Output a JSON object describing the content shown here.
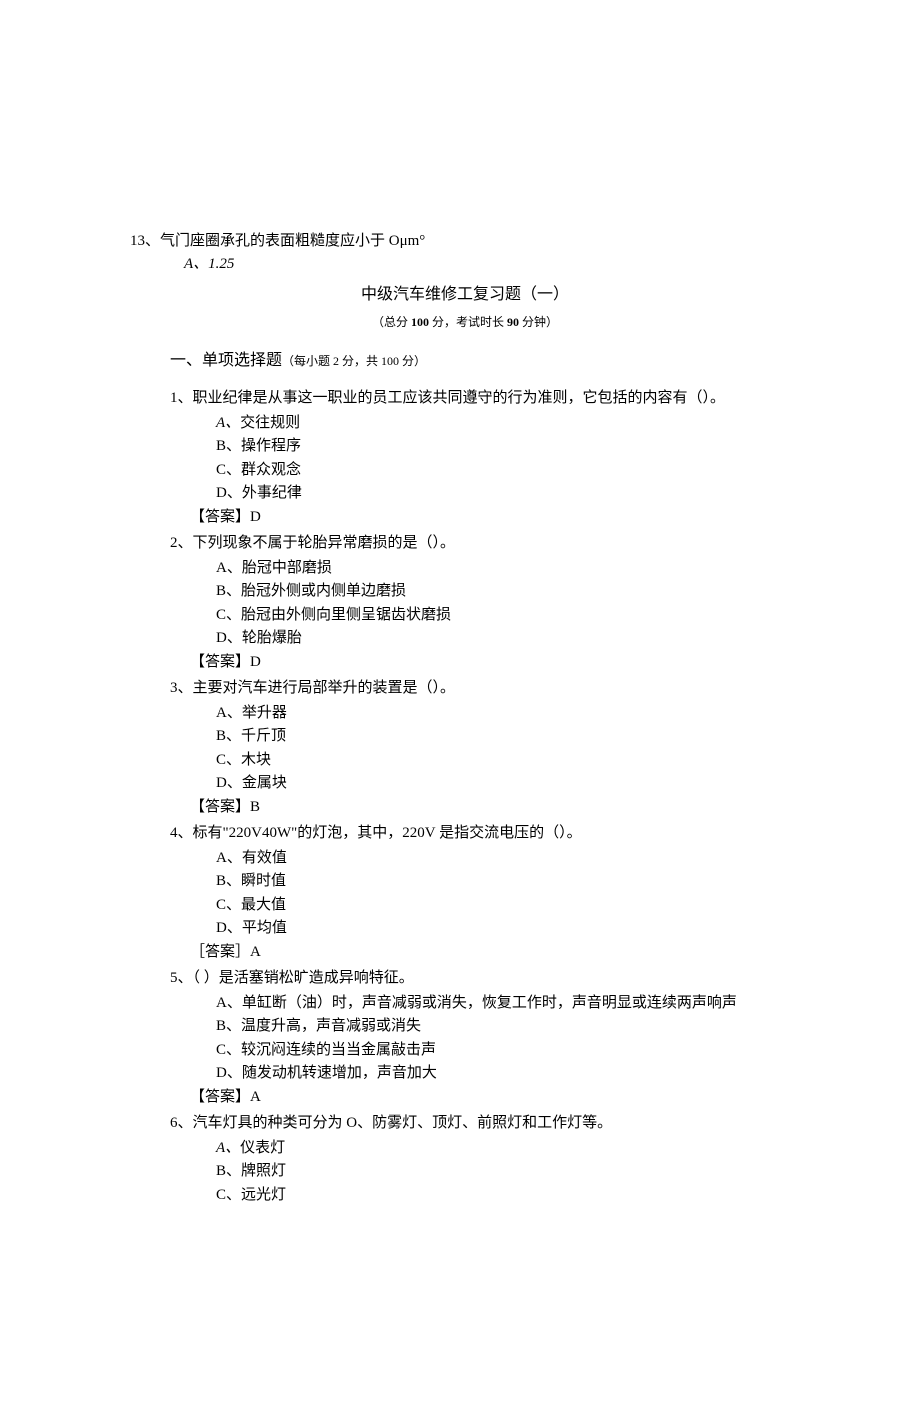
{
  "q13": {
    "num": "13、",
    "stem": "气门座圈承孔的表面粗糙度应小于 Oμm°",
    "opt_a_label": "A、",
    "opt_a_text": "1.25"
  },
  "title": "中级汽车维修工复习题（一）",
  "subtitle_prefix": "（总分 ",
  "subtitle_score": "100 ",
  "subtitle_mid": "分，考试时长 ",
  "subtitle_time": "90 ",
  "subtitle_suffix": "分钟）",
  "section": {
    "heading": "一、单项选择题",
    "note_prefix": "（每小题 ",
    "note_per": "2 ",
    "note_mid": "分，共 ",
    "note_total": "100 ",
    "note_suffix": "分）"
  },
  "questions": [
    {
      "num": "1、",
      "stem": "职业纪律是从事这一职业的员工应该共同遵守的行为准则，它包括的内容有（）。",
      "opts": [
        {
          "label": "A、",
          "italic": true,
          "text": "交往规则"
        },
        {
          "label": "B、",
          "text": "操作程序"
        },
        {
          "label": "C、",
          "text": "群众观念"
        },
        {
          "label": "D、",
          "text": "外事纪律"
        }
      ],
      "ans_label": "【答案】",
      "ans_val": "D"
    },
    {
      "num": "2、",
      "stem": "下列现象不属于轮胎异常磨损的是（）。",
      "opts": [
        {
          "label": "A、",
          "text": "胎冠中部磨损"
        },
        {
          "label": "B、",
          "text": "胎冠外侧或内侧单边磨损"
        },
        {
          "label": "C、",
          "text": "胎冠由外侧向里侧呈锯齿状磨损"
        },
        {
          "label": "D、",
          "text": "轮胎爆胎"
        }
      ],
      "ans_label": "【答案】",
      "ans_val": "D"
    },
    {
      "num": "3、",
      "stem": "主要对汽车进行局部举升的装置是（）。",
      "opts": [
        {
          "label": "A、",
          "text": "举升器"
        },
        {
          "label": "B、",
          "text": "千斤顶"
        },
        {
          "label": "C、",
          "text": "木块"
        },
        {
          "label": "D、",
          "text": "金属块"
        }
      ],
      "ans_label": "【答案】",
      "ans_val": "B"
    },
    {
      "num": "4、",
      "stem": "标有\"220V40W\"的灯泡，其中，220V 是指交流电压的（）。",
      "opts": [
        {
          "label": "A、",
          "text": "有效值"
        },
        {
          "label": "B、",
          "text": "瞬时值"
        },
        {
          "label": "C、",
          "text": "最大值"
        },
        {
          "label": "D、",
          "text": "平均值"
        }
      ],
      "ans_label": "［答案］",
      "ans_val": "A"
    },
    {
      "num": "5、",
      "stem": "（  ）是活塞销松旷造成异响特征。",
      "opts": [
        {
          "label": "A、",
          "text": "单缸断（油）时，声音减弱或消失，恢复工作时，声音明显或连续两声响声"
        },
        {
          "label": "B、",
          "text": "温度升高，声音减弱或消失"
        },
        {
          "label": "C、",
          "text": "较沉闷连续的当当金属敲击声"
        },
        {
          "label": "D、",
          "text": "随发动机转速增加，声音加大"
        }
      ],
      "ans_label": "【答案】",
      "ans_val": "A"
    },
    {
      "num": "6、",
      "stem": "汽车灯具的种类可分为 O、防雾灯、顶灯、前照灯和工作灯等。",
      "opts": [
        {
          "label": "A、",
          "italic": true,
          "text": "仪表灯"
        },
        {
          "label": "B、",
          "text": "牌照灯"
        },
        {
          "label": "C、",
          "text": "远光灯"
        }
      ]
    }
  ]
}
